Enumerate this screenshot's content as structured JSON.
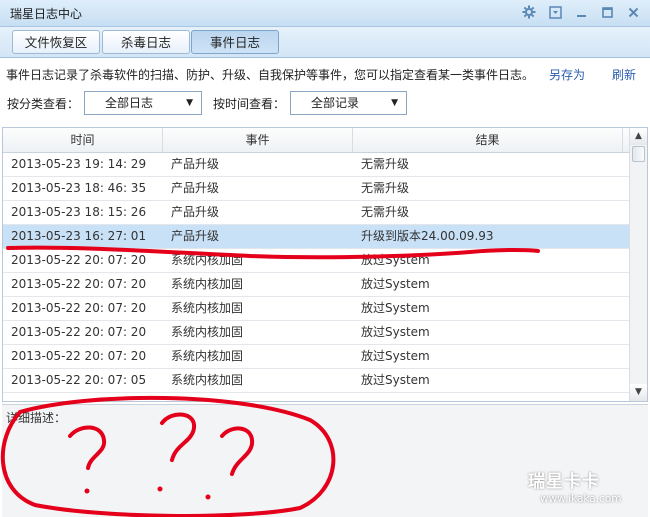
{
  "window": {
    "title": "瑞星日志中心"
  },
  "titlebar_buttons": [
    "gear-icon",
    "menu-icon",
    "minimize-icon",
    "maximize-icon",
    "close-icon"
  ],
  "tabs": [
    {
      "label": "文件恢复区",
      "active": false
    },
    {
      "label": "杀毒日志",
      "active": false
    },
    {
      "label": "事件日志",
      "active": true
    }
  ],
  "description": "事件日志记录了杀毒软件的扫描、防护、升级、自我保护等事件，您可以指定查看某一类事件日志。",
  "actions": {
    "save_as": "另存为",
    "refresh": "刷新"
  },
  "filters": {
    "category_label": "按分类查看：",
    "category_value": "全部日志",
    "time_label": "按时间查看：",
    "time_value": "全部记录"
  },
  "table": {
    "headers": [
      "时间",
      "事件",
      "结果"
    ],
    "rows": [
      {
        "time": "2013-05-23 19: 14: 29",
        "event": "产品升级",
        "result": "无需升级"
      },
      {
        "time": "2013-05-23 18: 46: 35",
        "event": "产品升级",
        "result": "无需升级"
      },
      {
        "time": "2013-05-23 18: 15: 26",
        "event": "产品升级",
        "result": "无需升级"
      },
      {
        "time": "2013-05-23 16: 27: 01",
        "event": "产品升级",
        "result": "升级到版本24.00.09.93",
        "selected": true
      },
      {
        "time": "2013-05-22 20: 07: 20",
        "event": "系统内核加固",
        "result": "放过System"
      },
      {
        "time": "2013-05-22 20: 07: 20",
        "event": "系统内核加固",
        "result": "放过System"
      },
      {
        "time": "2013-05-22 20: 07: 20",
        "event": "系统内核加固",
        "result": "放过System"
      },
      {
        "time": "2013-05-22 20: 07: 20",
        "event": "系统内核加固",
        "result": "放过System"
      },
      {
        "time": "2013-05-22 20: 07: 20",
        "event": "系统内核加固",
        "result": "放过System"
      },
      {
        "time": "2013-05-22 20: 07: 05",
        "event": "系统内核加固",
        "result": "放过System"
      }
    ]
  },
  "detail": {
    "label": "详细描述："
  },
  "annotation": {
    "text": "? ? ?",
    "color": "#e4001b"
  },
  "watermark": {
    "logo": "瑞星卡卡",
    "url": "www.ikaka.com"
  },
  "colors": {
    "selected_row": "#c9e1f7",
    "link": "#2a5db0",
    "annotation": "#e4001b"
  }
}
